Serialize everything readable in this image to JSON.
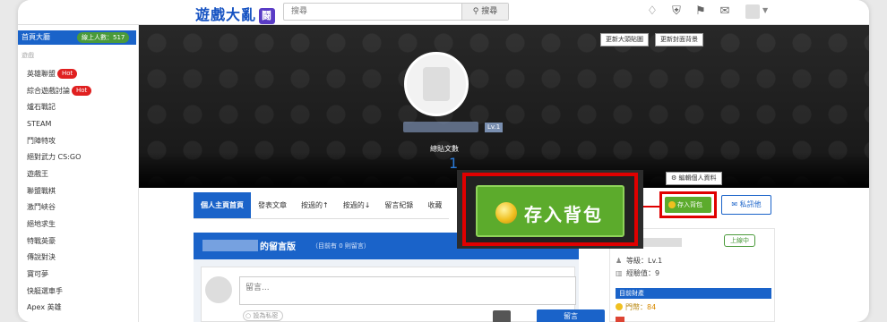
{
  "header": {
    "logo_text": "遊戲大亂",
    "logo_badge": "鬪",
    "search_placeholder": "搜尋",
    "search_button": "搜尋",
    "icons": [
      "bell-icon",
      "shield-icon",
      "flag-icon",
      "mail-icon",
      "avatar",
      "chevron-down-icon"
    ]
  },
  "sidebar": {
    "title": "首頁大廳",
    "online": "線上人數：517",
    "category": "遊戲",
    "items": [
      {
        "label": "英雄聯盟",
        "hot": "Hot"
      },
      {
        "label": "綜合遊戲討論",
        "hot": "Hot"
      },
      {
        "label": "爐石戰記",
        "hot": ""
      },
      {
        "label": "STEAM",
        "hot": ""
      },
      {
        "label": "鬥陣特攻",
        "hot": ""
      },
      {
        "label": "絕對武力 CS:GO",
        "hot": ""
      },
      {
        "label": "遊戲王",
        "hot": ""
      },
      {
        "label": "聯盟戰棋",
        "hot": ""
      },
      {
        "label": "激鬥峽谷",
        "hot": ""
      },
      {
        "label": "絕地求生",
        "hot": ""
      },
      {
        "label": "特戰英豪",
        "hot": ""
      },
      {
        "label": "傳說對決",
        "hot": ""
      },
      {
        "label": "寶可夢",
        "hot": ""
      },
      {
        "label": "快艇選車手",
        "hot": ""
      },
      {
        "label": "Apex 英雄",
        "hot": ""
      }
    ]
  },
  "cover": {
    "change_sticker_button": "更新大頭貼圖",
    "change_cover_button": "更新封面背景",
    "level": "Lv.1",
    "post_label": "總貼文數",
    "post_count": "1",
    "edit_profile_button": "編輯個人資料"
  },
  "tabs": [
    "個人主頁首頁",
    "發表文章",
    "按過的↑",
    "按過的↓",
    "留言紀錄",
    "收藏"
  ],
  "popup": {
    "save_bag_label": "存入背包"
  },
  "actions": {
    "save_bag_small": "存入背包",
    "message_button": "私訊他"
  },
  "guestbook": {
    "title": "的留言版",
    "count": "（目前有 0 則留言）",
    "placeholder": "留言...",
    "private_label": "設為私密",
    "submit": "留言"
  },
  "info": {
    "online_badge": "上線中",
    "level_label": "等級：Lv.1",
    "exp_label": "經驗值：9",
    "section_title": "目前財產",
    "coins_label": "門幣：",
    "coins_value": "84"
  },
  "colors": {
    "primary": "#1a63c9",
    "green": "#5cab2c",
    "highlight_red": "#e00000"
  }
}
